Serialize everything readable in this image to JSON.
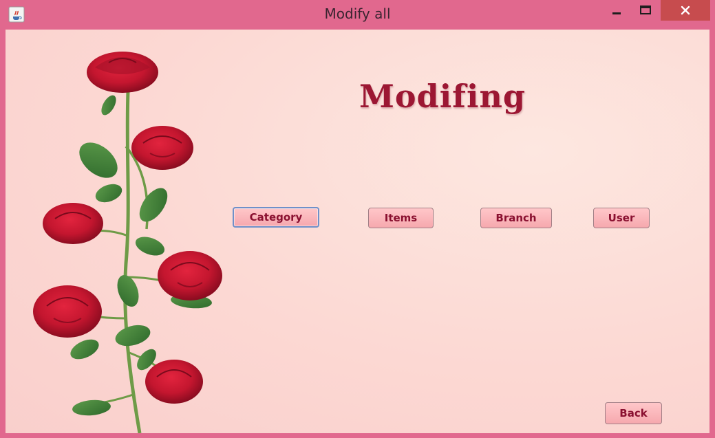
{
  "window": {
    "title": "Modify all"
  },
  "main": {
    "heading": "Modifing",
    "buttons": {
      "category": "Category",
      "items": "Items",
      "branch": "Branch",
      "user": "User",
      "back": "Back"
    }
  },
  "colors": {
    "frame": "#e1688e",
    "background": "#fcd8d3",
    "heading": "#9c1733",
    "button_fill": "#f6a8ae",
    "button_text": "#8a1030",
    "close_button": "#c74c4e"
  },
  "icons": {
    "app": "java-cup-icon",
    "minimize": "minimize-icon",
    "maximize": "maximize-icon",
    "close": "close-icon"
  }
}
